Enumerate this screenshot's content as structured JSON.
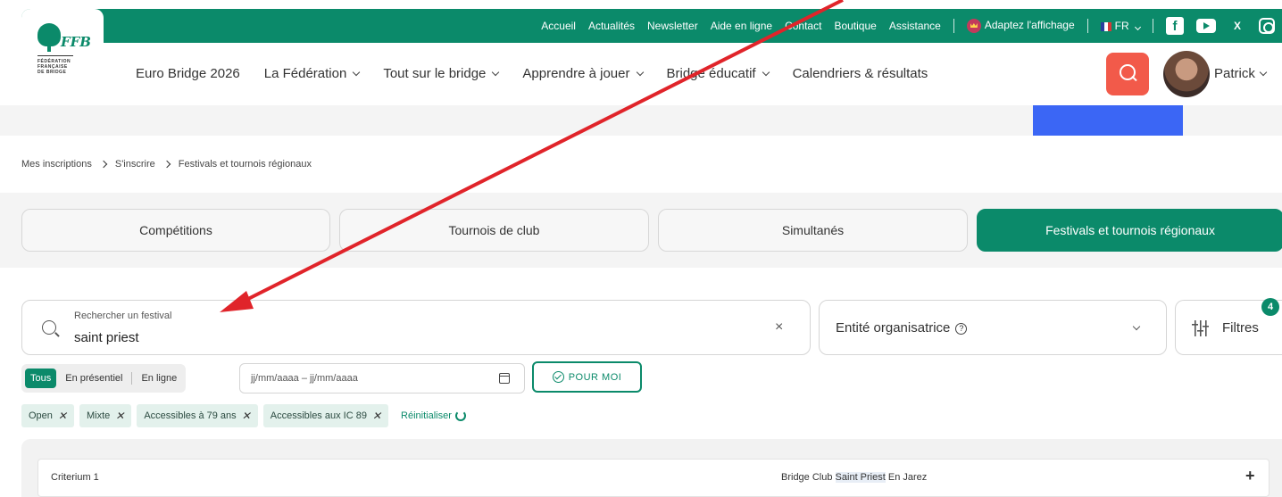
{
  "header": {
    "utility_links": [
      "Accueil",
      "Actualités",
      "Newsletter",
      "Aide en ligne",
      "Contact",
      "Boutique",
      "Assistance"
    ],
    "display_label": "Adaptez l'affichage",
    "language": "FR",
    "social_x": "X"
  },
  "logo": {
    "brand": "FFB",
    "subtitle_lines": [
      "FÉDÉRATION",
      "FRANÇAISE",
      "DE BRIDGE"
    ]
  },
  "main_nav": [
    "Euro Bridge 2026",
    "La Fédération",
    "Tout sur le bridge",
    "Apprendre à jouer",
    "Bridge éducatif",
    "Calendriers & résultats"
  ],
  "user": {
    "name": "Patrick"
  },
  "breadcrumb": [
    "Mes inscriptions",
    "S'inscrire",
    "Festivals et tournois régionaux"
  ],
  "tabs": [
    {
      "label": "Compétitions",
      "active": false
    },
    {
      "label": "Tournois de club",
      "active": false
    },
    {
      "label": "Simultanés",
      "active": false
    },
    {
      "label": "Festivals et tournois régionaux",
      "active": true
    }
  ],
  "search": {
    "label": "Rechercher un festival",
    "value": "saint priest",
    "clear": "×"
  },
  "entity": {
    "label": "Entité organisatrice",
    "help": "?"
  },
  "filters": {
    "label": "Filtres",
    "count": "4"
  },
  "mode": {
    "options": [
      "Tous",
      "En présentiel",
      "En ligne"
    ],
    "selected": "Tous"
  },
  "date_range": {
    "placeholder": "jj/mm/aaaa – jj/mm/aaaa"
  },
  "for_me": {
    "label": "POUR MOI"
  },
  "chips": [
    "Open",
    "Mixte",
    "Accessibles à 79 ans",
    "Accessibles aux IC 89"
  ],
  "reset_label": "Réinitialiser",
  "results": [
    {
      "name": "Criterium 1",
      "club_prefix": "Bridge Club ",
      "club_highlight": "Saint Priest",
      "club_suffix": " En Jarez",
      "expand": "+"
    }
  ],
  "colors": {
    "brand_green": "#0b8a6a",
    "search_red": "#f25a4a",
    "arrow_red": "#e0242a",
    "blue_block": "#3b66f5"
  }
}
